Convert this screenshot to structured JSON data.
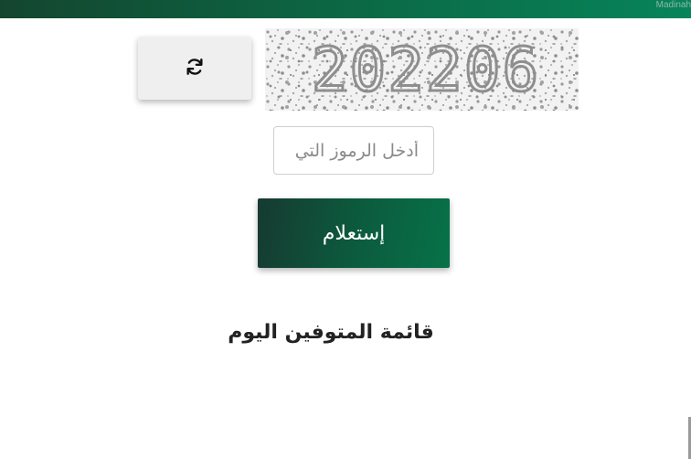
{
  "header": {
    "brand_text": "Madinah",
    "background_gradient": [
      "#14452f",
      "#07845a"
    ]
  },
  "captcha": {
    "refresh_icon": "refresh-icon",
    "image_text": "202206",
    "input_placeholder": "أدخل الرموز التي",
    "input_value": ""
  },
  "query_button": {
    "label": "إستعلام",
    "gradient": [
      "#163a30",
      "#077248"
    ]
  },
  "section": {
    "heading": "قائمة المتوفين اليوم"
  }
}
